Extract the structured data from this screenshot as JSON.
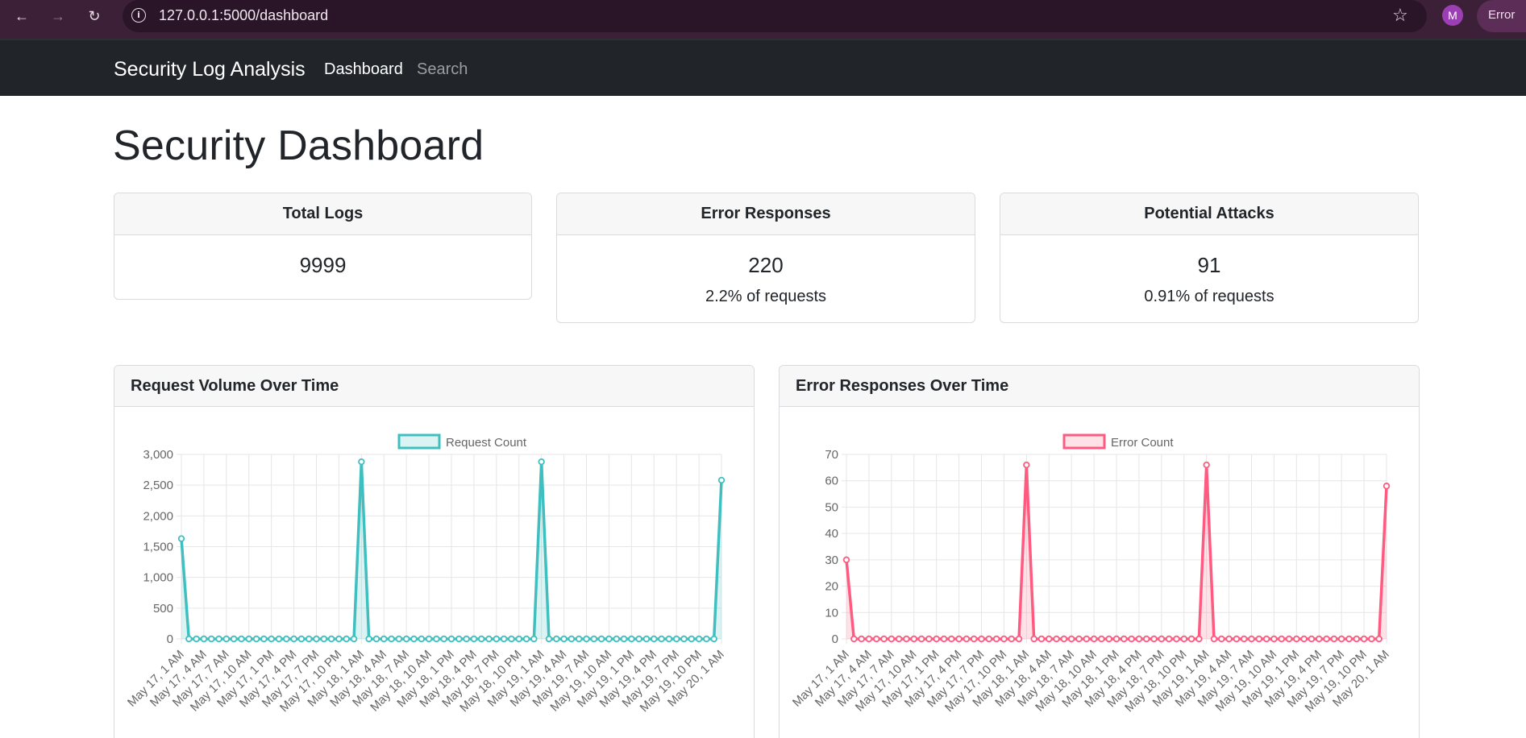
{
  "browser": {
    "url": "127.0.0.1:5000/dashboard",
    "avatar_letter": "M",
    "status_label": "Error"
  },
  "nav": {
    "brand": "Security Log Analysis",
    "links": [
      "Dashboard",
      "Search"
    ]
  },
  "page": {
    "title": "Security Dashboard"
  },
  "stats": [
    {
      "title": "Total Logs",
      "value": "9999",
      "sub": ""
    },
    {
      "title": "Error Responses",
      "value": "220",
      "sub": "2.2% of requests"
    },
    {
      "title": "Potential Attacks",
      "value": "91",
      "sub": "0.91% of requests"
    }
  ],
  "charts": {
    "request": {
      "title": "Request Volume Over Time"
    },
    "errors": {
      "title": "Error Responses Over Time"
    }
  },
  "chart_data": [
    {
      "type": "line",
      "title": "Request Volume Over Time",
      "ylim": [
        0,
        3000
      ],
      "yticks": [
        0,
        500,
        1000,
        1500,
        2000,
        2500,
        3000
      ],
      "ytick_labels": [
        "0",
        "500",
        "1,000",
        "1,500",
        "2,000",
        "2,500",
        "3,000"
      ],
      "grid": true,
      "legend": "top-center",
      "color": "#3fbfbf",
      "fill": "rgba(63,191,191,0.18)",
      "series": [
        {
          "name": "Request Count",
          "x_start": "May 17, 1 AM",
          "values": [
            1630,
            0,
            0,
            0,
            0,
            0,
            0,
            0,
            0,
            0,
            0,
            0,
            0,
            0,
            0,
            0,
            0,
            0,
            0,
            0,
            0,
            0,
            0,
            0,
            2880,
            0,
            0,
            0,
            0,
            0,
            0,
            0,
            0,
            0,
            0,
            0,
            0,
            0,
            0,
            0,
            0,
            0,
            0,
            0,
            0,
            0,
            0,
            0,
            2880,
            0,
            0,
            0,
            0,
            0,
            0,
            0,
            0,
            0,
            0,
            0,
            0,
            0,
            0,
            0,
            0,
            0,
            0,
            0,
            0,
            0,
            0,
            0,
            2580
          ]
        }
      ],
      "tick_labels": [
        "May 17, 1 AM",
        "May 17, 4 AM",
        "May 17, 7 AM",
        "May 17, 10 AM",
        "May 17, 1 PM",
        "May 17, 4 PM",
        "May 17, 7 PM",
        "May 17, 10 PM",
        "May 18, 1 AM",
        "May 18, 4 AM",
        "May 18, 7 AM",
        "May 18, 10 AM",
        "May 18, 1 PM",
        "May 18, 4 PM",
        "May 18, 7 PM",
        "May 18, 10 PM",
        "May 19, 1 AM",
        "May 19, 4 AM",
        "May 19, 7 AM",
        "May 19, 10 AM",
        "May 19, 1 PM",
        "May 19, 4 PM",
        "May 19, 7 PM",
        "May 19, 10 PM",
        "May 20, 1 AM"
      ]
    },
    {
      "type": "line",
      "title": "Error Responses Over Time",
      "ylim": [
        0,
        70
      ],
      "yticks": [
        0,
        10,
        20,
        30,
        40,
        50,
        60,
        70
      ],
      "ytick_labels": [
        "0",
        "10",
        "20",
        "30",
        "40",
        "50",
        "60",
        "70"
      ],
      "grid": true,
      "legend": "top-center",
      "color": "#ff5a80",
      "fill": "rgba(255,90,128,0.18)",
      "series": [
        {
          "name": "Error Count",
          "x_start": "May 17, 1 AM",
          "values": [
            30,
            0,
            0,
            0,
            0,
            0,
            0,
            0,
            0,
            0,
            0,
            0,
            0,
            0,
            0,
            0,
            0,
            0,
            0,
            0,
            0,
            0,
            0,
            0,
            66,
            0,
            0,
            0,
            0,
            0,
            0,
            0,
            0,
            0,
            0,
            0,
            0,
            0,
            0,
            0,
            0,
            0,
            0,
            0,
            0,
            0,
            0,
            0,
            66,
            0,
            0,
            0,
            0,
            0,
            0,
            0,
            0,
            0,
            0,
            0,
            0,
            0,
            0,
            0,
            0,
            0,
            0,
            0,
            0,
            0,
            0,
            0,
            58
          ]
        }
      ],
      "tick_labels": [
        "May 17, 1 AM",
        "May 17, 4 AM",
        "May 17, 7 AM",
        "May 17, 10 AM",
        "May 17, 1 PM",
        "May 17, 4 PM",
        "May 17, 7 PM",
        "May 17, 10 PM",
        "May 18, 1 AM",
        "May 18, 4 AM",
        "May 18, 7 AM",
        "May 18, 10 AM",
        "May 18, 1 PM",
        "May 18, 4 PM",
        "May 18, 7 PM",
        "May 18, 10 PM",
        "May 19, 1 AM",
        "May 19, 4 AM",
        "May 19, 7 AM",
        "May 19, 10 AM",
        "May 19, 1 PM",
        "May 19, 4 PM",
        "May 19, 7 PM",
        "May 19, 10 PM",
        "May 20, 1 AM"
      ]
    }
  ]
}
